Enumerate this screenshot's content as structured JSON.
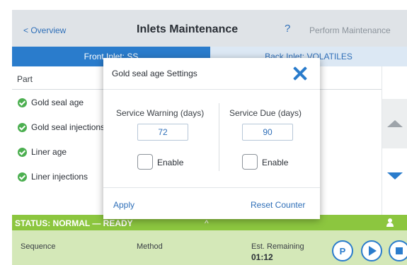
{
  "header": {
    "back_label": "< Overview",
    "title": "Inlets Maintenance",
    "help": "?",
    "perform_label": "Perform Maintenance"
  },
  "tabs": [
    {
      "label": "Front Inlet: SS"
    },
    {
      "label": "Back Inlet: VOLATILES"
    }
  ],
  "table": {
    "column_header": "Part",
    "rows": [
      {
        "label": "Gold seal age",
        "status_icon": "check-circle-icon"
      },
      {
        "label": "Gold seal injections",
        "status_icon": "check-circle-icon"
      },
      {
        "label": "Liner age",
        "status_icon": "check-circle-icon"
      },
      {
        "label": "Liner injections",
        "status_icon": "check-circle-icon"
      }
    ]
  },
  "modal": {
    "title": "Gold seal age Settings",
    "warning_label": "Service Warning (days)",
    "warning_value": "72",
    "due_label": "Service Due (days)",
    "due_value": "90",
    "enable_label": "Enable",
    "apply_label": "Apply",
    "reset_label": "Reset Counter"
  },
  "status": {
    "text": "STATUS: NORMAL — READY",
    "chevron": "^"
  },
  "run": {
    "sequence_label": "Sequence",
    "method_label": "Method",
    "remaining_label": "Est. Remaining",
    "remaining_value": "01:12",
    "p_glyph": "P"
  },
  "colors": {
    "accent": "#2a7ccc",
    "status_green": "#8cc63f",
    "run_bar": "#d4e8b8",
    "check_green": "#4caf50"
  }
}
